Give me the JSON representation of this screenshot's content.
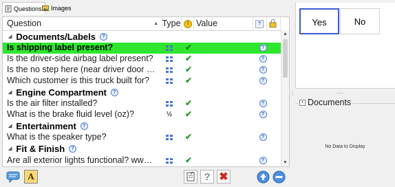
{
  "tabs": [
    {
      "label": "Questions",
      "active": true
    },
    {
      "label": "Images",
      "active": false
    }
  ],
  "grid": {
    "columns": {
      "question": "Question",
      "type": "Type",
      "value": "Value"
    },
    "groups": [
      {
        "label": "Documents/Labels",
        "rows": [
          {
            "question": "Is shipping label present?",
            "type": "grid-icon",
            "answered": true,
            "selected": true
          },
          {
            "question": "Is the driver-side airbag label present?",
            "type": "grid-icon",
            "answered": true
          },
          {
            "question": "Is the no step here (near driver door - ...",
            "type": "grid-icon",
            "answered": true
          },
          {
            "question": "Which customer is this truck built for?",
            "type": "grid-icon",
            "answered": true
          }
        ]
      },
      {
        "label": "Engine Compartment",
        "rows": [
          {
            "question": "Is the air filter installed?",
            "type": "grid-icon",
            "answered": true
          },
          {
            "question": "What is the brake fluid level (oz)?",
            "type": "½",
            "answered": true
          }
        ]
      },
      {
        "label": "Entertainment",
        "rows": [
          {
            "question": "What is the speaker type?",
            "type": "grid-icon",
            "answered": true
          }
        ]
      },
      {
        "label": "Fit & Finish",
        "rows": [
          {
            "question": "Are all exterior lights functional? www...",
            "type": "grid-icon",
            "answered": true
          }
        ]
      }
    ]
  },
  "answer_buttons": {
    "yes": "Yes",
    "no": "No"
  },
  "splitter_dots": ".....",
  "documents": {
    "title": "Documents",
    "empty_text": "No Data to Display"
  },
  "colors": {
    "selected_row": "#2ee62e",
    "yes_border": "#3b5bd6",
    "check": "#2e9b2e"
  }
}
